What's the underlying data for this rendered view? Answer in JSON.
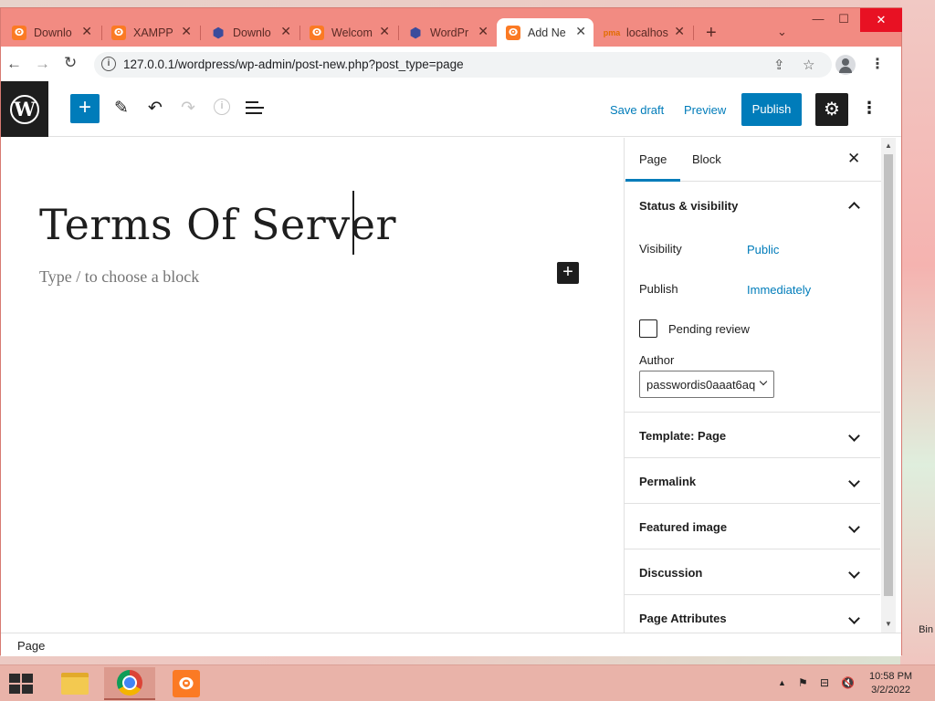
{
  "browser": {
    "tabs": [
      {
        "label": "Downlo",
        "favicon": "xampp-icon"
      },
      {
        "label": "XAMPP",
        "favicon": "xampp-icon"
      },
      {
        "label": "Downlo",
        "favicon": "wordpress-hexagon-icon"
      },
      {
        "label": "Welcom",
        "favicon": "xampp-icon"
      },
      {
        "label": "WordPr",
        "favicon": "wordpress-hexagon-icon"
      },
      {
        "label": "Add Ne",
        "favicon": "xampp-icon",
        "active": true
      },
      {
        "label": "localhos",
        "favicon": "phpmyadmin-icon"
      }
    ],
    "url": "127.0.0.1/wordpress/wp-admin/post-new.php?post_type=page"
  },
  "editor": {
    "header": {
      "save_draft": "Save draft",
      "preview": "Preview",
      "publish": "Publish"
    },
    "title": "Terms Of Server",
    "block_placeholder": "Type / to choose a block",
    "footer_breadcrumb": "Page"
  },
  "sidebar": {
    "tabs": {
      "page": "Page",
      "block": "Block"
    },
    "status_visibility": {
      "title": "Status & visibility",
      "visibility_label": "Visibility",
      "visibility_value": "Public",
      "publish_label": "Publish",
      "publish_value": "Immediately",
      "pending_review": "Pending review",
      "author_label": "Author",
      "author_value": "passwordis0aaat6aq"
    },
    "panels": [
      "Template: Page",
      "Permalink",
      "Featured image",
      "Discussion",
      "Page Attributes"
    ]
  },
  "desktop": {
    "recycle_bin_partial": "Bin"
  },
  "taskbar": {
    "time": "10:58 PM",
    "date": "3/2/2022"
  },
  "colors": {
    "accent": "#007cba",
    "browser_frame": "#f28b82",
    "wp_dark": "#1e1e1e"
  }
}
